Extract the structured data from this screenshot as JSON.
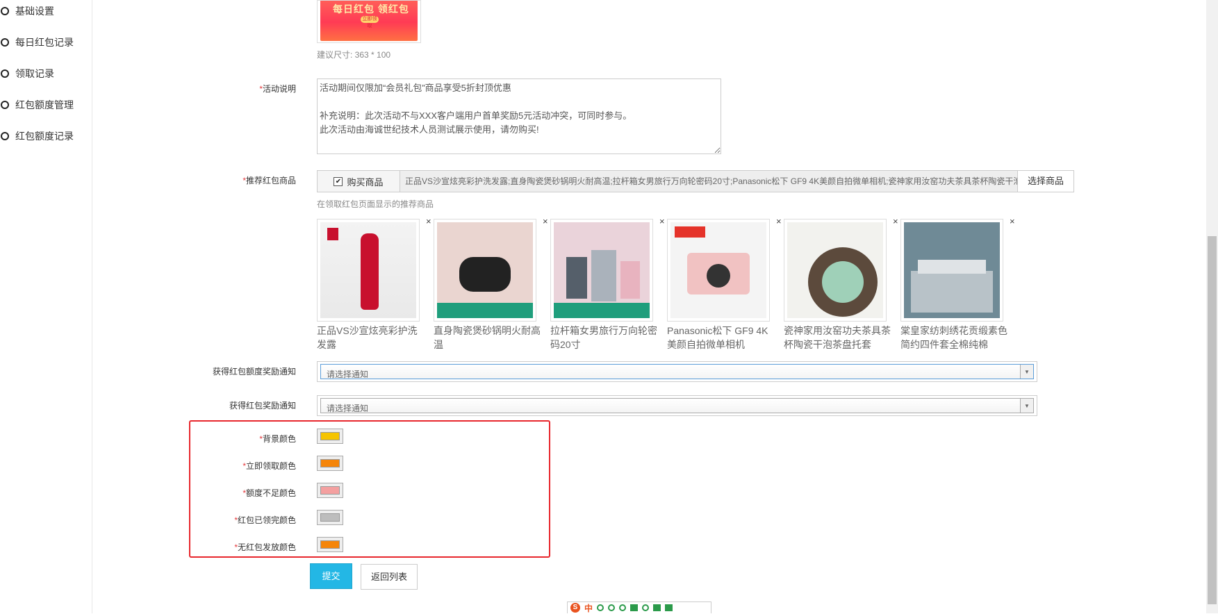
{
  "sidebar": {
    "items": [
      {
        "label": "基础设置"
      },
      {
        "label": "每日红包记录"
      },
      {
        "label": "领取记录"
      },
      {
        "label": "红包额度管理"
      },
      {
        "label": "红包额度记录"
      }
    ]
  },
  "banner": {
    "image_text": "每日红包 领红包",
    "pill_text": "立即领取",
    "size_hint": "建议尺寸: 363 * 100"
  },
  "activity": {
    "label": "活动说明",
    "value": "活动期间仅限加“会员礼包”商品享受5折封顶优惠\n\n补充说明：此次活动不与XXX客户端用户首单奖励5元活动冲突，可同时参与。\n此次活动由海诚世纪技术人员测试展示使用，请勿购买!"
  },
  "goods": {
    "label": "推荐红包商品",
    "checkbox_label": "购买商品",
    "checkbox_mark": "✔",
    "selected_text": "正品VS沙宣炫亮彩护洗发露;直身陶瓷煲砂锅明火耐高温;拉杆箱女男旅行万向轮密码20寸;Panasonic松下 GF9 4K美颜自拍微单相机;瓷神家用汝窑功夫茶具茶杯陶瓷干泡茶盘托套",
    "select_button": "选择商品",
    "hint": "在领取红包页面显示的推荐商品",
    "products": [
      {
        "name": "正品VS沙宣炫亮彩护洗发露",
        "color": "#c8102e",
        "close": "×"
      },
      {
        "name": "直身陶瓷煲砂锅明火耐高温",
        "color": "#2a2a2a",
        "close": "×"
      },
      {
        "name": "拉杆箱女男旅行万向轮密码20寸",
        "color": "#9aa3ad",
        "close": "×"
      },
      {
        "name": "Panasonic松下 GF9 4K美颜自拍微单相机",
        "color": "#f1c2c2",
        "close": "×"
      },
      {
        "name": "瓷神家用汝窑功夫茶具茶杯陶瓷干泡茶盘托套",
        "color": "#9fd0b8",
        "close": "×"
      },
      {
        "name": "棠皇家纺刺绣花贡缎素色简约四件套全棉纯棉",
        "color": "#8a9aa6",
        "close": "×"
      }
    ]
  },
  "notify": {
    "quota_label": "获得红包额度奖励通知",
    "quota_placeholder": "请选择通知",
    "reward_label": "获得红包奖励通知",
    "reward_placeholder": "请选择通知",
    "arrow": "▼"
  },
  "colors": {
    "items": [
      {
        "label": "背景颜色",
        "value": "#f5c400"
      },
      {
        "label": "立即领取颜色",
        "value": "#f5850a"
      },
      {
        "label": "额度不足颜色",
        "value": "#f4a0a0"
      },
      {
        "label": "红包已领完颜色",
        "value": "#bdbdbd"
      },
      {
        "label": "无红包发放颜色",
        "value": "#f5850a"
      }
    ]
  },
  "actions": {
    "submit": "提交",
    "back": "返回列表"
  },
  "required_mark": "*",
  "ime": {
    "logo": "S",
    "lang": "中"
  }
}
